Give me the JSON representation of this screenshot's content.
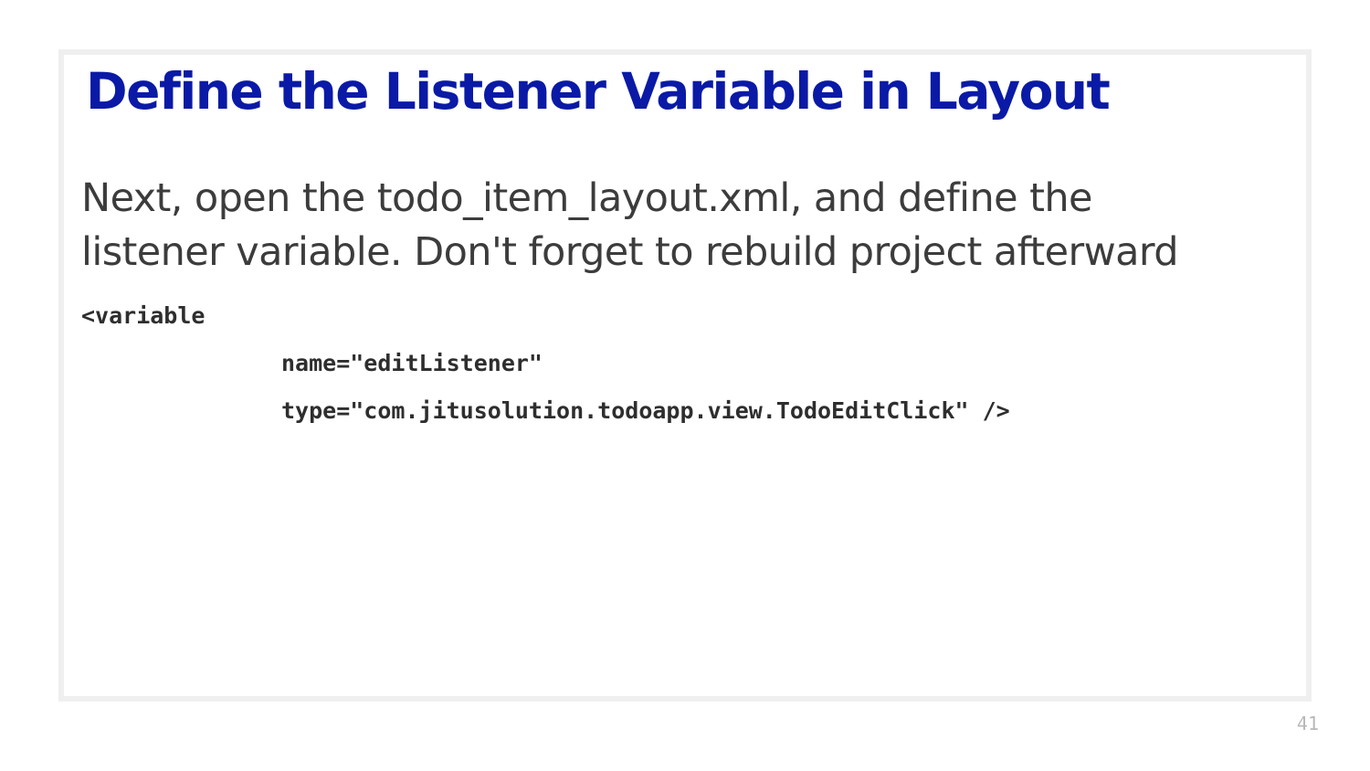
{
  "slide": {
    "title": "Define the Listener Variable in Layout",
    "body_lines": [
      "Next, open the todo_item_layout.xml, and define the",
      "listener variable. Don't forget to rebuild project afterward"
    ],
    "code_lines": [
      "<variable",
      "name=\"editListener\"",
      "type=\"com.jitusolution.todoapp.view.TodoEditClick\" />"
    ],
    "page_number": "41"
  },
  "colors": {
    "title": "#0a1aa6",
    "body_text": "#3c3c3c",
    "code_text": "#2e2e2e",
    "frame_border": "#efefef",
    "page_number": "#b8b8b8"
  }
}
